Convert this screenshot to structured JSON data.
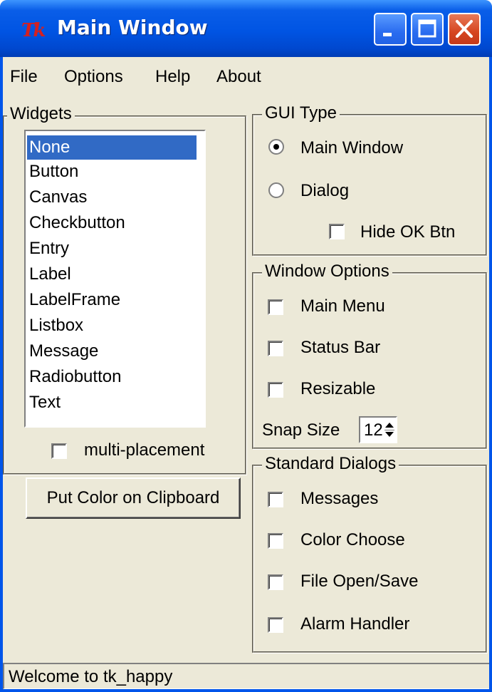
{
  "window": {
    "title": "Main Window",
    "app_icon": "tk-feather-icon",
    "tk_glyph": "Tk",
    "controls": [
      "minimize-icon",
      "maximize-icon",
      "close-icon"
    ]
  },
  "menubar": {
    "items": [
      {
        "label": "File"
      },
      {
        "label": "Options"
      },
      {
        "label": "Help"
      },
      {
        "label": "About"
      }
    ]
  },
  "widgets": {
    "title": "Widgets",
    "items": [
      {
        "label": "None",
        "selected": true
      },
      {
        "label": "Button",
        "selected": false
      },
      {
        "label": "Canvas",
        "selected": false
      },
      {
        "label": "Checkbutton",
        "selected": false
      },
      {
        "label": "Entry",
        "selected": false
      },
      {
        "label": "Label",
        "selected": false
      },
      {
        "label": "LabelFrame",
        "selected": false
      },
      {
        "label": "Listbox",
        "selected": false
      },
      {
        "label": "Message",
        "selected": false
      },
      {
        "label": "Radiobutton",
        "selected": false
      },
      {
        "label": "Text",
        "selected": false
      }
    ],
    "multi_placement_label": "multi-placement",
    "multi_placement_checked": false,
    "clipboard_button_label": "Put Color on Clipboard"
  },
  "gui_type": {
    "title": "GUI Type",
    "main_window_label": "Main Window",
    "main_window_selected": true,
    "dialog_label": "Dialog",
    "dialog_selected": false,
    "hide_ok_label": "Hide OK Btn",
    "hide_ok_checked": false
  },
  "window_options": {
    "title": "Window Options",
    "main_menu_label": "Main Menu",
    "status_bar_label": "Status Bar",
    "resizable_label": "Resizable",
    "snap_size_label": "Snap Size",
    "snap_size_value": "12"
  },
  "standard_dialogs": {
    "title": "Standard Dialogs",
    "messages_label": "Messages",
    "color_choose_label": "Color Choose",
    "file_open_save_label": "File Open/Save",
    "alarm_handler_label": "Alarm Handler"
  },
  "statusbar": {
    "text": "Welcome to tk_happy"
  },
  "colors": {
    "title_bar": "#0054e3",
    "window_bg": "#ece9d8",
    "selection": "#316ac5",
    "close_button": "#d6451f"
  }
}
